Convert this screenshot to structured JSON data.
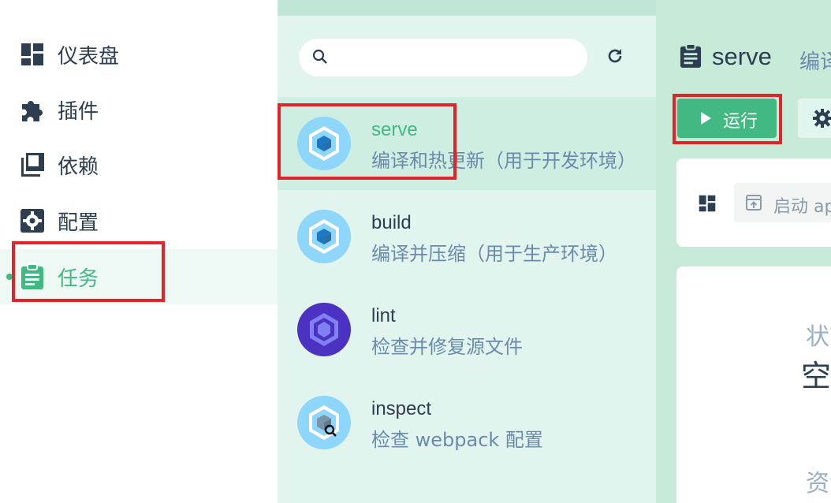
{
  "sidebar": {
    "items": [
      {
        "label": "仪表盘",
        "icon": "dashboard-icon",
        "active": false
      },
      {
        "label": "插件",
        "icon": "puzzle-icon",
        "active": false
      },
      {
        "label": "依赖",
        "icon": "library-icon",
        "active": false
      },
      {
        "label": "配置",
        "icon": "settings-box-icon",
        "active": false
      },
      {
        "label": "任务",
        "icon": "clipboard-icon",
        "active": true
      }
    ]
  },
  "tasks": {
    "search": {
      "value": "",
      "placeholder": ""
    },
    "items": [
      {
        "name": "serve",
        "description": "编译和热更新（用于开发环境）",
        "icon": "webpack-icon",
        "selected": true
      },
      {
        "name": "build",
        "description": "编译并压缩（用于生产环境）",
        "icon": "webpack-icon",
        "selected": false
      },
      {
        "name": "lint",
        "description": "检查并修复源文件",
        "icon": "eslint-icon",
        "selected": false
      },
      {
        "name": "inspect",
        "description": "检查 webpack 配置",
        "icon": "webpack-inspect-icon",
        "selected": false
      }
    ]
  },
  "detail": {
    "title": "serve",
    "subtitle": "编译和热更新（用于开发环境）",
    "run_label": "运行",
    "command_text": "启动 app",
    "status_label": "状态",
    "status_value": "空闲",
    "resource_label": "资源"
  },
  "colors": {
    "accent": "#42b983",
    "highlight_box": "#e02428",
    "text_dark": "#2c3e50",
    "text_muted": "#6a8bad"
  }
}
